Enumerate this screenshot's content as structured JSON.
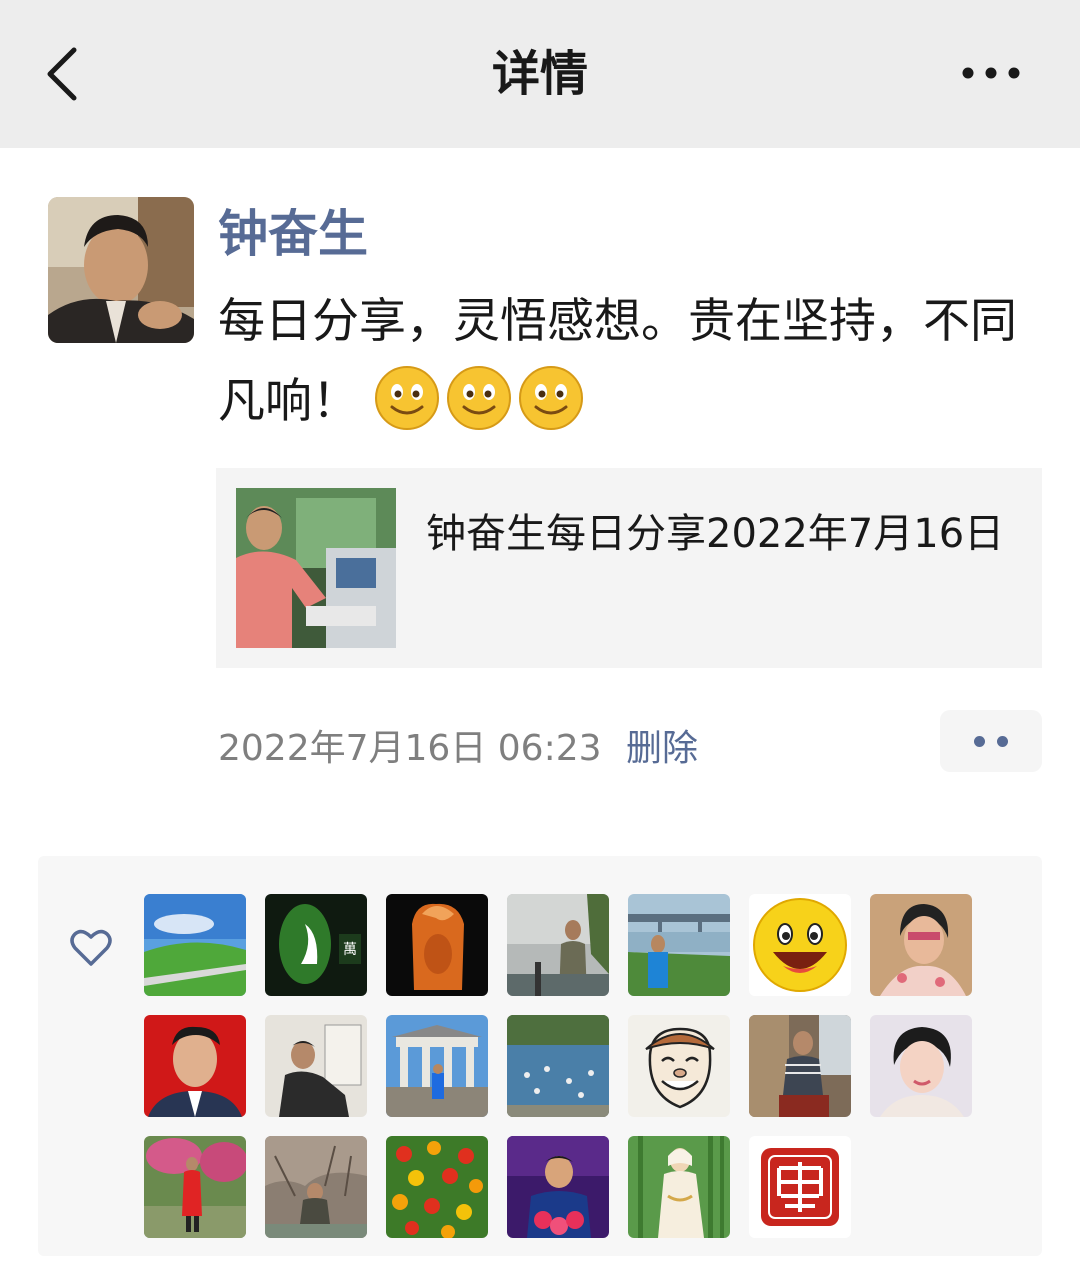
{
  "nav": {
    "title": "详情"
  },
  "post": {
    "author": "钟奋生",
    "text": "每日分享，灵悟感想。贵在坚持，不同凡响！",
    "emojis": [
      "smiley",
      "smiley",
      "smiley"
    ],
    "link": {
      "title": "钟奋生每日分享2022年7月16日"
    },
    "timestamp": "2022年7月16日 06:23",
    "delete_label": "删除"
  },
  "likes": {
    "icon": "heart-outline-icon",
    "count": 19
  },
  "colors": {
    "link_blue": "#576b95",
    "nav_bg": "#ededed",
    "panel_bg": "#f7f7f7"
  }
}
